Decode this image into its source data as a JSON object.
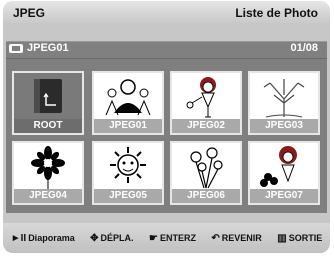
{
  "header": {
    "title": "JPEG",
    "mode_title": "Liste de Photo"
  },
  "breadcrumb": {
    "folder": "JPEG01",
    "page": "01/08"
  },
  "thumbs": [
    {
      "label": "ROOT"
    },
    {
      "label": "JPEG01"
    },
    {
      "label": "JPEG02"
    },
    {
      "label": "JPEG03"
    },
    {
      "label": "JPEG04"
    },
    {
      "label": "JPEG05"
    },
    {
      "label": "JPEG06"
    },
    {
      "label": "JPEG07"
    }
  ],
  "footer": {
    "slideshow": "Diaporama",
    "move": "DÉPLA.",
    "enter": "ENTERZ",
    "back": "REVENIR",
    "exit": "SORTIE"
  }
}
